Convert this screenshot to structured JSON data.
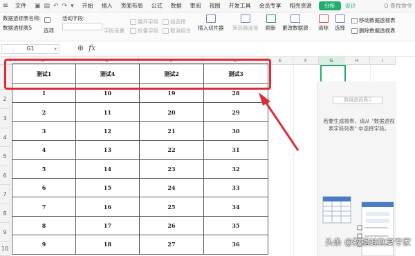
{
  "menubar": {
    "file": "文件",
    "items": [
      "开始",
      "插入",
      "页面布局",
      "公式",
      "数据",
      "审阅",
      "视图",
      "开发工具",
      "会员专享",
      "稻壳资源"
    ],
    "analyze_tab": "分析",
    "design_tab": "设计",
    "search": "Q 查找命令"
  },
  "ribbon": {
    "pivot_name_label": "数据透视表名称:",
    "pivot_name_value": "数据透视表5",
    "options": "选项",
    "active_field_label": "活动字段:",
    "field_settings": "字段设置",
    "expand_field": "展开字段",
    "collapse_field": "折叠字段",
    "group_selection": "组选择",
    "ungroup": "取消组合",
    "insert_slicer": "插入切片器",
    "filter_connections": "筛选器连接",
    "refresh": "刷新",
    "change_source": "更改数据源",
    "clear": "清除",
    "select": "选择",
    "move_pivot": "移动数据透视表",
    "delete_pivot": "删除数据透视表"
  },
  "formula_bar": {
    "cell_ref": "G1",
    "fx": "fx"
  },
  "grid": {
    "columns": [
      "A",
      "B",
      "C",
      "D",
      "E",
      "F",
      "G",
      "H",
      "I"
    ],
    "rows": [
      "1",
      "2",
      "3",
      "4",
      "5",
      "6",
      "7",
      "8",
      "9",
      "10"
    ],
    "selected_column": "G"
  },
  "table": {
    "headers": [
      "测试1",
      "测试4",
      "测试2",
      "测试3"
    ],
    "rows": [
      [
        "1",
        "10",
        "19",
        "28"
      ],
      [
        "2",
        "11",
        "20",
        "29"
      ],
      [
        "3",
        "12",
        "21",
        "30"
      ],
      [
        "4",
        "13",
        "22",
        "31"
      ],
      [
        "5",
        "14",
        "23",
        "32"
      ],
      [
        "6",
        "15",
        "24",
        "33"
      ],
      [
        "7",
        "16",
        "25",
        "34"
      ],
      [
        "8",
        "17",
        "26",
        "35"
      ],
      [
        "9",
        "18",
        "27",
        "36"
      ]
    ]
  },
  "pivot_panel": {
    "title": "数据透视表5",
    "message": "若要生成报表，请从 \"数据透视表字段列表\" 中选择字段。"
  },
  "watermark": "头条 @数据蛙恢复专家",
  "colors": {
    "accent": "#1fae6e",
    "highlight": "#e02b35"
  }
}
